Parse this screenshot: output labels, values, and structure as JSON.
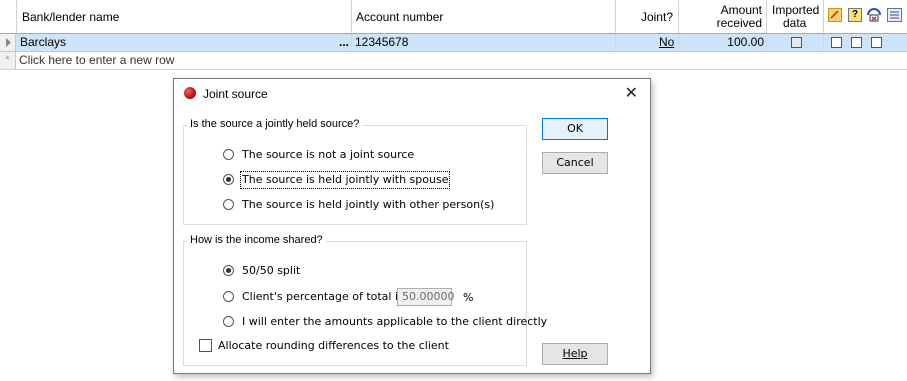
{
  "grid": {
    "columns": {
      "bank_name": "Bank/lender name",
      "account_number": "Account number",
      "joint": "Joint?",
      "amount_line1": "Amount",
      "amount_line2": "received",
      "imported_line1": "Imported",
      "imported_line2": "data"
    },
    "header_icons": [
      "note-icon",
      "help-icon",
      "filter-icon",
      "list-icon"
    ],
    "row": {
      "bank_name": "Barclays",
      "ellipsis": "...",
      "account_number": "12345678",
      "joint": "No",
      "amount": "100.00"
    },
    "new_row_marker": "*",
    "new_row_text": "Click here to enter a new row"
  },
  "dialog": {
    "title": "Joint source",
    "close_glyph": "✕",
    "group1": {
      "label": "Is the source a jointly held source?",
      "options": [
        "The source is not a joint source",
        "The source is held jointly with spouse",
        "The source is held jointly with other person(s)"
      ],
      "selected": 1
    },
    "group2": {
      "label": "How is the income shared?",
      "options": [
        "50/50 split",
        "Client's percentage of total is",
        "I will enter the amounts applicable to the client directly"
      ],
      "selected": 0,
      "percentage_value": "50.00000",
      "percent_sign": "%"
    },
    "rounding_checkbox": "Allocate rounding differences to the client",
    "buttons": {
      "ok": "OK",
      "cancel": "Cancel",
      "help": "Help"
    }
  }
}
